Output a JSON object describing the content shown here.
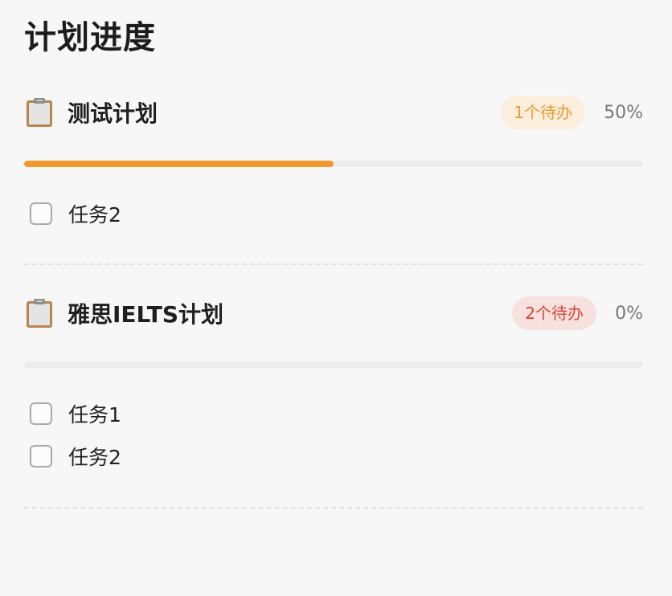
{
  "page": {
    "title": "计划进度"
  },
  "plans": [
    {
      "icon": "clipboard-icon",
      "name": "测试计划",
      "badge": "1个待办",
      "badge_color": "#ea9a2e",
      "percent_label": "50%",
      "progress": 0.5,
      "tasks": [
        {
          "label": "任务2",
          "checked": false
        }
      ]
    },
    {
      "icon": "clipboard-icon",
      "name": "雅思IELTS计划",
      "badge": "2个待办",
      "badge_color": "#d94437",
      "percent_label": "0%",
      "progress": 0,
      "tasks": [
        {
          "label": "任务1",
          "checked": false
        },
        {
          "label": "任务2",
          "checked": false
        }
      ]
    }
  ],
  "colors": {
    "progress_fill": "#f09a2b",
    "progress_track": "#ececec",
    "background": "#f7f7f7"
  }
}
